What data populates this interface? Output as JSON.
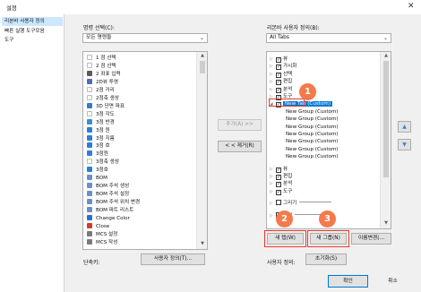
{
  "window": {
    "title": "설정",
    "close_glyph": "✕"
  },
  "nav": {
    "items": [
      {
        "label": "리본바 사용자 정의",
        "selected": true
      },
      {
        "label": "빠른 실행 도구모음",
        "selected": false
      },
      {
        "label": "도구",
        "selected": false
      }
    ]
  },
  "commands": {
    "label": "명령 선택(C):",
    "combo_value": "모든 명령들",
    "items": [
      {
        "label": "1 점 선택",
        "icon": "point-icon",
        "color": "#ffffff"
      },
      {
        "label": "2 점 선택",
        "icon": "two-point-icon",
        "color": "#ffffff"
      },
      {
        "label": "2 좌표 입력",
        "icon": "coordinate-icon",
        "color": "#5a5a5a"
      },
      {
        "label": "2D뷰 투영",
        "icon": "view-2d-icon",
        "color": "#4a6fb5"
      },
      {
        "label": "2점 거리",
        "icon": "distance-icon",
        "color": "#ffffff"
      },
      {
        "label": "2점축 생성",
        "icon": "axis-icon",
        "color": "#ffffff"
      },
      {
        "label": "3D 단면 파표",
        "icon": "section-3d-icon",
        "color": "#3a78c8"
      },
      {
        "label": "3점 각도",
        "icon": "angle-icon",
        "color": "#ffffff"
      },
      {
        "label": "3점 반경",
        "icon": "radius-icon",
        "color": "#3e8bd6"
      },
      {
        "label": "3점 원",
        "icon": "circle-icon",
        "color": "#2e7ed6"
      },
      {
        "label": "3점 지름",
        "icon": "diameter-icon",
        "color": "#2e7ed6"
      },
      {
        "label": "3점 호",
        "icon": "arc-icon",
        "color": "#2e7ed6"
      },
      {
        "label": "3점원",
        "icon": "circle-3pt-icon",
        "color": "#2e7ed6"
      },
      {
        "label": "3점축 생성",
        "icon": "axis-3pt-icon",
        "color": "#ffffff"
      },
      {
        "label": "3점호",
        "icon": "arc-3pt-icon",
        "color": "#2e7ed6"
      },
      {
        "label": "BOM",
        "icon": "bom-icon",
        "color": "#6c8ecb"
      },
      {
        "label": "BOM 주석 생성",
        "icon": "bom-note-icon",
        "color": "#6c8ecb"
      },
      {
        "label": "BOM 주석 설정",
        "icon": "bom-setting-icon",
        "color": "#6c8ecb"
      },
      {
        "label": "BOM 주석 위치 변경",
        "icon": "bom-move-icon",
        "color": "#6c8ecb"
      },
      {
        "label": "BOM 파트 리스트",
        "icon": "bom-list-icon",
        "color": "#6c8ecb"
      },
      {
        "label": "Change Color",
        "icon": "color-icon",
        "color": "#2a6fc9"
      },
      {
        "label": "Close",
        "icon": "close-file-icon",
        "color": "#d33b2c"
      },
      {
        "label": "MCS 설정",
        "icon": "mcs-setting-icon",
        "color": "#7a7a7a"
      },
      {
        "label": "MCS 작성",
        "icon": "mcs-create-icon",
        "color": "#7a7a7a"
      }
    ]
  },
  "shortcut": {
    "label": "단축키:",
    "button": "사용자 정의(T)..."
  },
  "middle": {
    "add": "추가(A) >>",
    "remove": "< < 제거(R)"
  },
  "ribbon": {
    "label": "리본바 사용자 정의(B):",
    "combo_value": "All Tabs",
    "items": [
      {
        "kind": "item",
        "indent": 0,
        "expander": "▷",
        "label": "뷰"
      },
      {
        "kind": "item",
        "indent": 0,
        "expander": "▷",
        "label": "가시화"
      },
      {
        "kind": "item",
        "indent": 0,
        "expander": "▷",
        "label": "선택"
      },
      {
        "kind": "item",
        "indent": 0,
        "expander": "▷",
        "label": "편집"
      },
      {
        "kind": "item",
        "indent": 0,
        "expander": "▷",
        "label": "분석"
      },
      {
        "kind": "item",
        "indent": 0,
        "expander": "▷",
        "label": "도구"
      },
      {
        "kind": "item",
        "indent": 0,
        "expander": "◢",
        "label": "New Tab (Custom)",
        "selected": true
      },
      {
        "kind": "group",
        "indent": 1,
        "label": "New Group (Custom)"
      },
      {
        "kind": "group",
        "indent": 1,
        "label": "New Group (Custom)"
      },
      {
        "kind": "group",
        "indent": 1,
        "label": "New Group (Custom)"
      },
      {
        "kind": "group",
        "indent": 1,
        "label": "New Group (Custom)"
      },
      {
        "kind": "group",
        "indent": 1,
        "label": "New Group (Custom)"
      },
      {
        "kind": "group",
        "indent": 1,
        "label": "New Group (Custom)"
      },
      {
        "kind": "group",
        "indent": 1,
        "label": "New Group (Custom)"
      },
      {
        "kind": "spacer"
      },
      {
        "kind": "item",
        "indent": 0,
        "expander": "▷",
        "label": "뷰"
      },
      {
        "kind": "item",
        "indent": 0,
        "expander": "▷",
        "label": "편집"
      },
      {
        "kind": "item",
        "indent": 0,
        "expander": "▷",
        "label": "분석"
      },
      {
        "kind": "item",
        "indent": 0,
        "expander": "▷",
        "label": "도구"
      },
      {
        "kind": "spacer"
      },
      {
        "kind": "sep",
        "indent": 0,
        "label": "그리기"
      },
      {
        "kind": "spacer"
      },
      {
        "kind": "sep",
        "indent": 0,
        "label": "측정"
      }
    ],
    "new_tab": "새 탭(W)",
    "new_group": "새 그룹(N)",
    "rename": "이름변경(...",
    "custom_label": "사용자 정의:",
    "reset": "초기화(S)",
    "up_glyph": "▲",
    "down_glyph": "▼"
  },
  "callouts": [
    "1",
    "2",
    "3"
  ],
  "footer": {
    "ok": "확인",
    "cancel": "취소"
  },
  "colors": {
    "accent": "#f47a4c",
    "highlight": "#e8382c",
    "selection": "#0078d7"
  }
}
